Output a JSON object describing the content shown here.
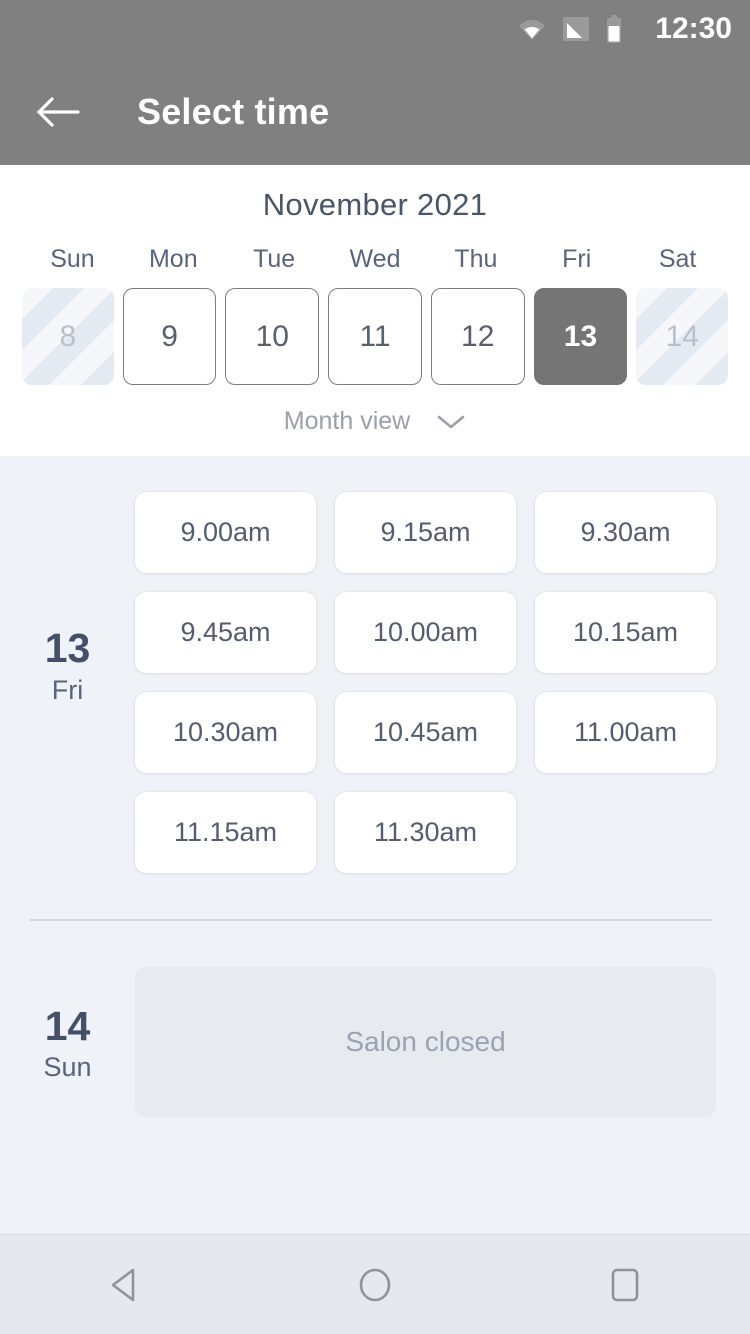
{
  "status_bar": {
    "clock": "12:30",
    "icons": [
      "wifi-icon",
      "signal-icon",
      "battery-icon"
    ]
  },
  "app_bar": {
    "back_icon": "back-arrow-icon",
    "title": "Select time"
  },
  "calendar": {
    "month_title": "November 2021",
    "weekdays": [
      "Sun",
      "Mon",
      "Tue",
      "Wed",
      "Thu",
      "Fri",
      "Sat"
    ],
    "dates": [
      {
        "day": "8",
        "state": "disabled"
      },
      {
        "day": "9",
        "state": "available"
      },
      {
        "day": "10",
        "state": "available"
      },
      {
        "day": "11",
        "state": "available"
      },
      {
        "day": "12",
        "state": "available"
      },
      {
        "day": "13",
        "state": "selected"
      },
      {
        "day": "14",
        "state": "disabled"
      }
    ],
    "month_view_label": "Month view",
    "month_view_icon": "chevron-down-icon"
  },
  "schedule": [
    {
      "day_num": "13",
      "day_of_week": "Fri",
      "slots": [
        "9.00am",
        "9.15am",
        "9.30am",
        "9.45am",
        "10.00am",
        "10.15am",
        "10.30am",
        "10.45am",
        "11.00am",
        "11.15am",
        "11.30am"
      ]
    },
    {
      "day_num": "14",
      "day_of_week": "Sun",
      "closed_label": "Salon closed"
    }
  ],
  "nav_bar": {
    "back_icon": "nav-back-triangle-icon",
    "home_icon": "nav-home-circle-icon",
    "recents_icon": "nav-recents-square-icon"
  },
  "colors": {
    "app_bar_bg": "#808080",
    "page_bg": "#eff2f7",
    "panel_bg": "#ffffff",
    "text_dark": "#44506a",
    "text_muted": "#9aa3b4",
    "selected_date_bg": "#757575",
    "closed_box_bg": "#e7eaee"
  }
}
